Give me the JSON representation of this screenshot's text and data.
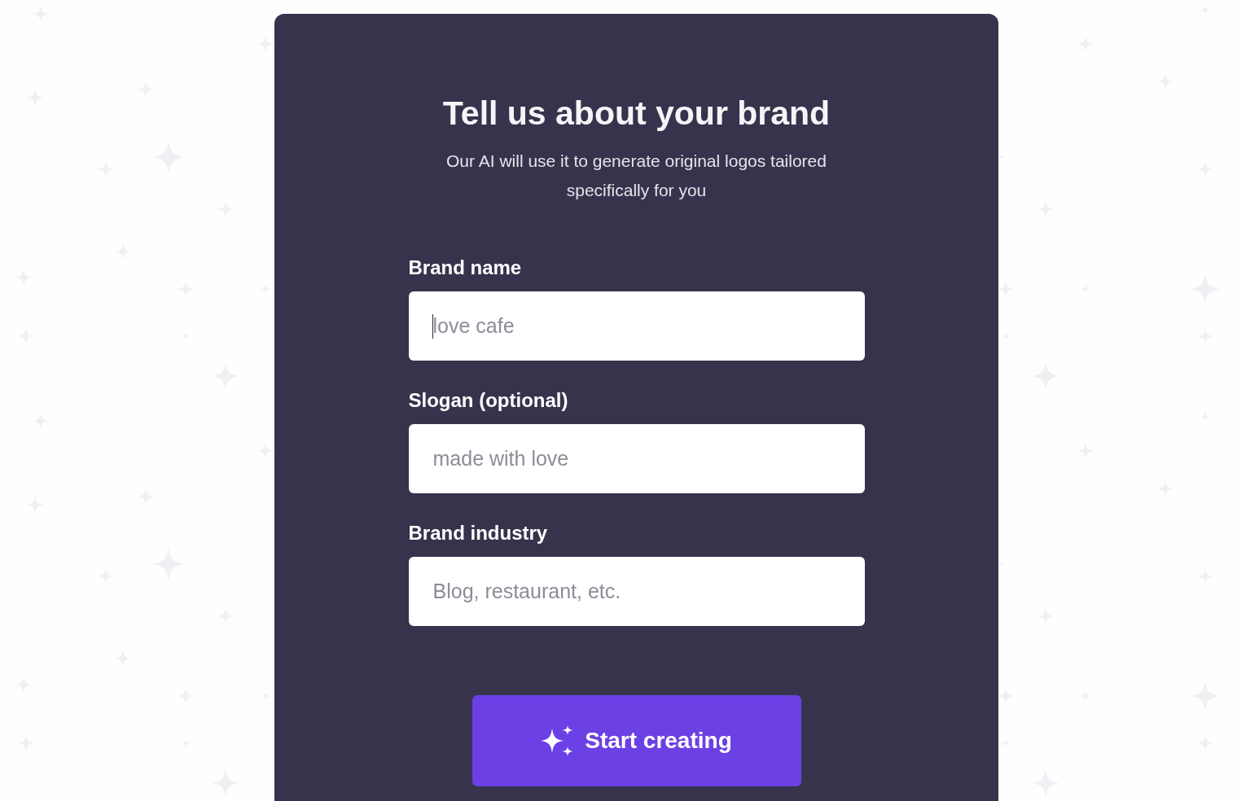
{
  "heading": "Tell us about your brand",
  "subheading": "Our AI will use it to generate original logos tailored specifically for you",
  "fields": [
    {
      "label": "Brand name",
      "placeholder": "love cafe",
      "focused": true
    },
    {
      "label": "Slogan (optional)",
      "placeholder": "made with love",
      "focused": false
    },
    {
      "label": "Brand industry",
      "placeholder": "Blog, restaurant, etc.",
      "focused": false
    }
  ],
  "submit_button": {
    "label": "Start creating"
  }
}
